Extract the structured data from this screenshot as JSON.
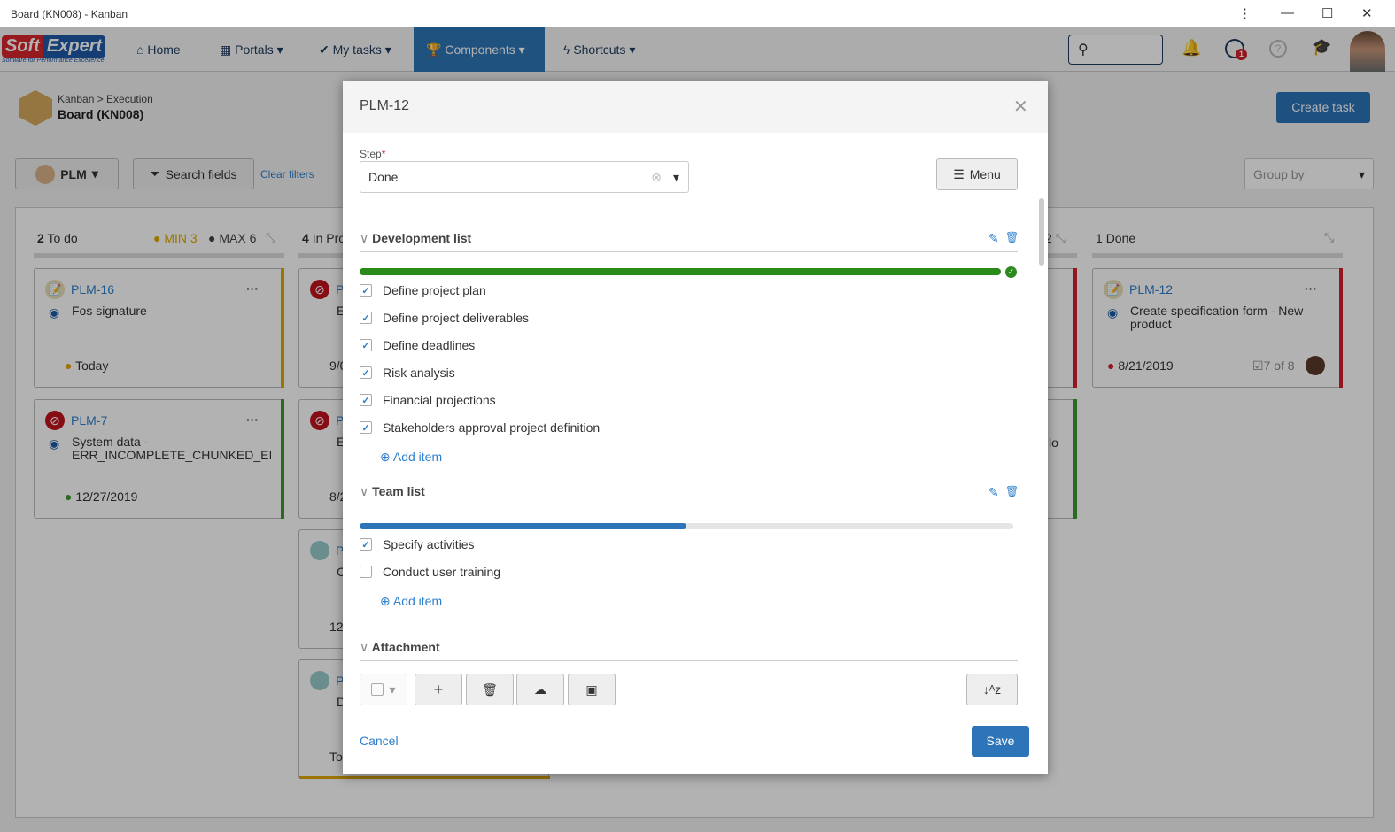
{
  "window": {
    "title": "Board (KN008) - Kanban"
  },
  "nav": {
    "logo_main": "SoftExpert",
    "logo_tagline": "Software for Performance Excellence",
    "items": [
      {
        "label": "Home",
        "icon": "home-icon"
      },
      {
        "label": "Portals",
        "icon": "grid-icon"
      },
      {
        "label": "My tasks",
        "icon": "check-icon"
      },
      {
        "label": "Components",
        "icon": "trophy-icon",
        "active": true
      },
      {
        "label": "Shortcuts",
        "icon": "bolt-icon"
      }
    ],
    "notification_badge": "1"
  },
  "header": {
    "breadcrumb": "Kanban > Execution",
    "title": "Board (KN008)",
    "create_task": "Create task"
  },
  "toolbar": {
    "board_select": "PLM",
    "search_fields": "Search fields",
    "clear_filters": "Clear filters",
    "group_by_placeholder": "Group by"
  },
  "columns": [
    {
      "count": "2",
      "name": "To do",
      "min": "MIN 3",
      "max": "MAX 6"
    },
    {
      "count": "4",
      "name": "In Pro"
    },
    {
      "count": "2"
    },
    {
      "count": "1",
      "name": "Done"
    }
  ],
  "cards": {
    "todo": [
      {
        "id": "PLM-16",
        "desc": "Fos signature",
        "date": "Today",
        "edge": "#e0a800"
      },
      {
        "id": "PLM-7",
        "desc": "System data - ERR_INCOMPLETE_CHUNKED_EI",
        "date": "12/27/2019",
        "edge": "#3c9a2e"
      }
    ],
    "inprogress": [
      {
        "id": "P",
        "desc": "E n",
        "date": "9/0"
      },
      {
        "id": "P",
        "desc": "E a",
        "date": "8/2"
      },
      {
        "id": "P",
        "desc": "C",
        "date": "12"
      },
      {
        "id": "P",
        "desc": "D",
        "date": "To"
      }
    ],
    "col3": [
      {
        "desc": ""
      },
      {
        "desc": "lo"
      }
    ],
    "done": [
      {
        "id": "PLM-12",
        "desc": "Create specification form - New product",
        "date": "8/21/2019",
        "checklist": "7 of 8",
        "edge": "#d0202a"
      }
    ]
  },
  "modal": {
    "title": "PLM-12",
    "step_label": "Step",
    "step_required": "*",
    "step_value": "Done",
    "menu": "Menu",
    "dev_list": {
      "title": "Development list",
      "progress": 100,
      "items": [
        {
          "label": "Define project plan",
          "checked": true
        },
        {
          "label": "Define project deliverables",
          "checked": true
        },
        {
          "label": "Define deadlines",
          "checked": true
        },
        {
          "label": "Risk analysis",
          "checked": true
        },
        {
          "label": "Financial projections",
          "checked": true
        },
        {
          "label": "Stakeholders approval project definition",
          "checked": true
        }
      ],
      "add_item": "Add item"
    },
    "team_list": {
      "title": "Team list",
      "progress": 50,
      "items": [
        {
          "label": "Specify activities",
          "checked": true
        },
        {
          "label": "Conduct user training",
          "checked": false
        }
      ],
      "add_item": "Add item"
    },
    "attachment": {
      "title": "Attachment"
    },
    "cancel": "Cancel",
    "save": "Save"
  },
  "colors": {
    "accent": "#2d7fcc",
    "progress_done": "#2a8a1a",
    "progress": "#2d74b8",
    "nav_active": "#2e76b8"
  }
}
